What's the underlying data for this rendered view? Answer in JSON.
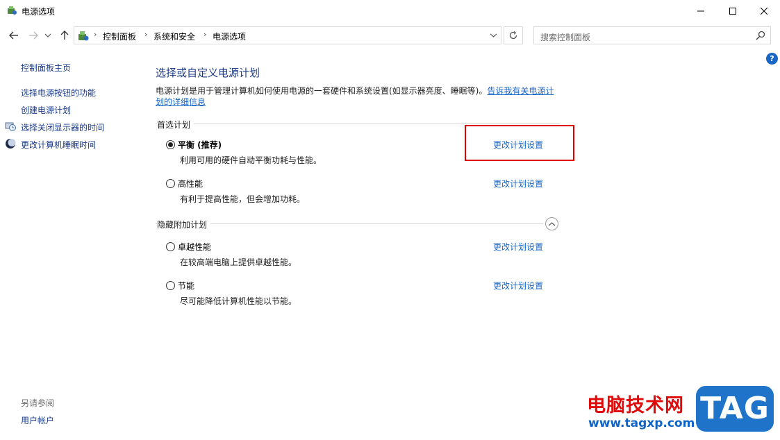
{
  "window": {
    "title": "电源选项",
    "controls": [
      "minimize",
      "maximize",
      "close"
    ]
  },
  "nav": {
    "breadcrumb": [
      "控制面板",
      "系统和安全",
      "电源选项"
    ],
    "search_placeholder": "搜索控制面板"
  },
  "sidebar": {
    "home": "控制面板主页",
    "items": [
      {
        "label": "选择电源按钮的功能",
        "icon": null
      },
      {
        "label": "创建电源计划",
        "icon": null
      },
      {
        "label": "选择关闭显示器的时间",
        "icon": "monitor-clock-icon"
      },
      {
        "label": "更改计算机睡眠时间",
        "icon": "moon-icon"
      }
    ],
    "see_also_title": "另请参阅",
    "see_also_items": [
      "用户帐户"
    ]
  },
  "main": {
    "heading": "选择或自定义电源计划",
    "description": "电源计划是用于管理计算机如何使用电源的一套硬件和系统设置(如显示器亮度、睡眠等)。",
    "description_link": "告诉我有关电源计划的详细信息",
    "preferred_title": "首选计划",
    "hidden_title": "隐藏附加计划",
    "change_link": "更改计划设置",
    "preferred_plans": [
      {
        "name": "平衡 (推荐)",
        "desc": "利用可用的硬件自动平衡功耗与性能。",
        "selected": true
      },
      {
        "name": "高性能",
        "desc": "有利于提高性能，但会增加功耗。",
        "selected": false
      }
    ],
    "hidden_plans": [
      {
        "name": "卓越性能",
        "desc": "在较高端电脑上提供卓越性能。",
        "selected": false
      },
      {
        "name": "节能",
        "desc": "尽可能降低计算机性能以节能。",
        "selected": false
      }
    ]
  },
  "watermark": {
    "text": "电脑技术网",
    "url": "www.tagxp.com",
    "badge": "TAG"
  },
  "colors": {
    "link": "#1a66c4",
    "heading": "#1e3c8a",
    "highlight": "#e00000"
  }
}
